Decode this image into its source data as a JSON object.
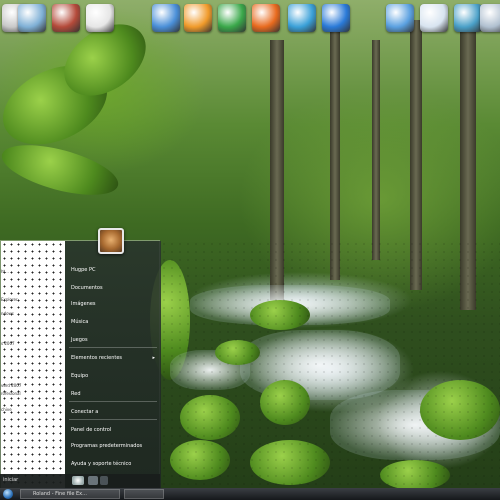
{
  "desktop": {
    "icons": [
      {
        "name": "recycle-bin-icon",
        "color": "#c8c8c8"
      },
      {
        "name": "folder-icon",
        "color": "#7fb0d6"
      },
      {
        "name": "winrar-icon",
        "color": "#b44a3a"
      },
      {
        "name": "document-icon",
        "color": "#e6e6e6"
      },
      {
        "name": "globe-icon",
        "color": "#4a8fd8"
      },
      {
        "name": "media-player-icon",
        "color": "#f09a2a"
      },
      {
        "name": "utorrent-icon",
        "color": "#3aa84a"
      },
      {
        "name": "firefox-icon",
        "color": "#e86a1e"
      },
      {
        "name": "messenger-icon",
        "color": "#3aa0d8"
      },
      {
        "name": "internet-explorer-icon",
        "color": "#2a7ad8"
      },
      {
        "name": "computer-icon",
        "color": "#5aa0e0"
      },
      {
        "name": "notepad-icon",
        "color": "#d8e4f0"
      },
      {
        "name": "network-icon",
        "color": "#4aa0c8"
      },
      {
        "name": "cd-drive-icon",
        "color": "#b0c0d0"
      }
    ]
  },
  "start_menu": {
    "right_items": [
      {
        "label": "Hugpe PC"
      },
      {
        "label": "Documentos"
      },
      {
        "label": "Imágenes"
      },
      {
        "label": "Música"
      },
      {
        "label": "Juegos"
      },
      {
        "label": "Elementos recientes",
        "has_arrow": true
      },
      {
        "label": "Equipo"
      },
      {
        "label": "Red"
      },
      {
        "label": "Conectar a"
      },
      {
        "label": "Panel de control"
      },
      {
        "label": "Programas predeterminados"
      },
      {
        "label": "Ayuda y soporte técnico"
      }
    ],
    "left_snippets": [
      "ht...",
      "Explorer",
      "ndows",
      "s 2007",
      "vord 2007",
      "rofesional",
      "chive"
    ],
    "search_label": "iniciar"
  },
  "taskbar": {
    "buttons": [
      {
        "label": "Roland - Fine file Ex..."
      },
      {
        "label": ""
      }
    ]
  },
  "colors": {
    "menu_text": "#ffffff",
    "menu_bg": "#28322d",
    "taskbar": "#1d2024"
  }
}
